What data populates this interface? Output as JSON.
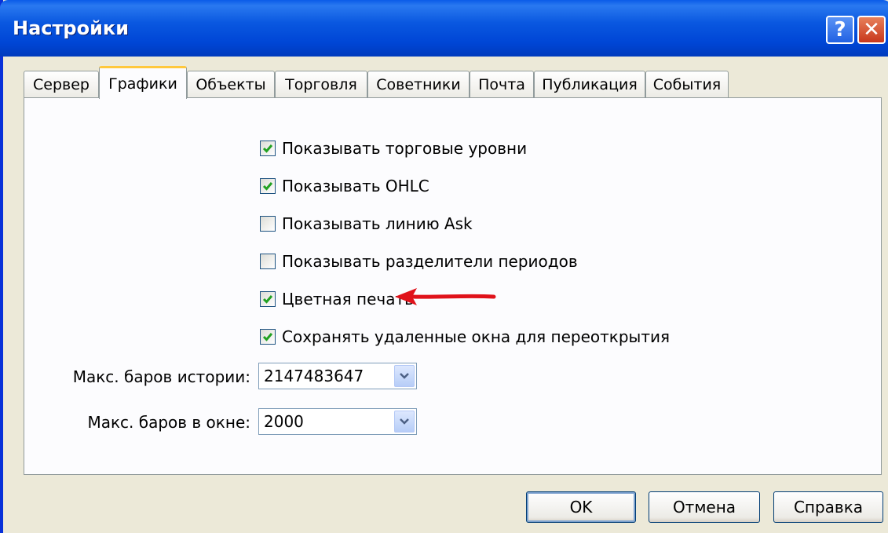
{
  "window": {
    "title": "Настройки",
    "help_glyph": "?",
    "close_glyph": "✕"
  },
  "tabs": [
    {
      "label": "Сервер",
      "active": false
    },
    {
      "label": "Графики",
      "active": true
    },
    {
      "label": "Объекты",
      "active": false
    },
    {
      "label": "Торговля",
      "active": false
    },
    {
      "label": "Советники",
      "active": false
    },
    {
      "label": "Почта",
      "active": false
    },
    {
      "label": "Публикация",
      "active": false
    },
    {
      "label": "События",
      "active": false
    }
  ],
  "options": [
    {
      "label": "Показывать торговые уровни",
      "checked": true
    },
    {
      "label": "Показывать OHLC",
      "checked": true
    },
    {
      "label": "Показывать линию Ask",
      "checked": false
    },
    {
      "label": "Показывать разделители периодов",
      "checked": false
    },
    {
      "label": "Цветная печать",
      "checked": true
    },
    {
      "label": "Сохранять удаленные окна для переоткрытия",
      "checked": true
    }
  ],
  "fields": {
    "max_history_bars": {
      "label": "Макс. баров истории:",
      "value": "2147483647"
    },
    "max_window_bars": {
      "label": "Макс. баров в окне:",
      "value": "2000"
    }
  },
  "buttons": {
    "ok": "OK",
    "cancel": "Отмена",
    "help": "Справка"
  },
  "colors": {
    "titlebar": "#0054e3",
    "checkmark": "#21a121",
    "annotation_arrow": "#e0121a",
    "active_tab_highlight": "#ffc83c"
  },
  "icons": {
    "help": "help-icon",
    "close": "close-icon",
    "dropdown": "chevron-down-icon",
    "checkmark": "checkmark-icon",
    "annotation": "red-arrow-icon"
  }
}
